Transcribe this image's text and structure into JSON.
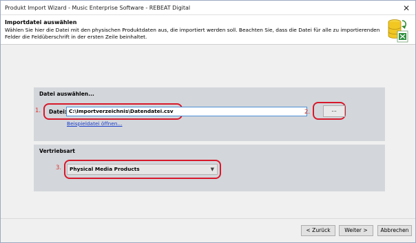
{
  "window": {
    "title": "Produkt Import Wizard - Music Enterprise Software - REBEAT Digital",
    "close_glyph": "✕"
  },
  "header": {
    "title": "Importdatei auswählen",
    "description": "Wählen Sie hier die Datei mit den physischen Produktdaten aus, die importiert werden soll. Beachten Sie, dass die Datei für alle zu importierenden Felder die Feldüberschrift in der ersten Zeile beinhaltet.",
    "icon": "database-file-icon"
  },
  "file_section": {
    "title": "Datei auswählen...",
    "step_number": "1.",
    "label": "Datei:",
    "value": "C:\\Importverzeichnis\\Datendatei.csv",
    "browse_step": "2.",
    "browse_label": "...",
    "sample_link": "Beispieldatei öffnen..."
  },
  "sales_section": {
    "title": "Vertriebsart",
    "step_number": "3.",
    "selected": "Physical Media Products"
  },
  "footer": {
    "back_label": "< Zurück",
    "next_label": "Weiter >",
    "cancel_label": "Abbrechen"
  },
  "colors": {
    "annotation_red": "#d7182a",
    "panel_bg": "#d3d6db",
    "link_blue": "#1a3fc9",
    "input_focus_border": "#4a8fd6"
  }
}
